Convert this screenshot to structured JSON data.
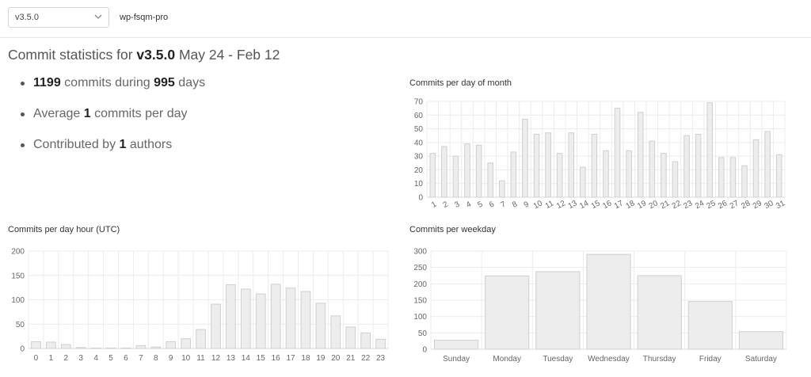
{
  "header": {
    "version_select": "v3.5.0",
    "repo": "wp-fsqm-pro"
  },
  "summary": {
    "prefix": "Commit statistics for",
    "version": "v3.5.0",
    "range": "May 24 - Feb 12"
  },
  "stats": [
    {
      "bold": "1199",
      "text": "commits during",
      "bold2": "995",
      "text2": "days"
    },
    {
      "pre": "Average",
      "bold": "1",
      "text": "commits per day"
    },
    {
      "pre": "Contributed by",
      "bold": "1",
      "text": "authors"
    }
  ],
  "colors": {
    "bar_fill": "#ededed",
    "bar_stroke": "#cfcfcf",
    "grid": "#ececec",
    "tick_text": "#666666"
  },
  "chart_data": [
    {
      "id": "day-of-month",
      "type": "bar",
      "title": "Commits per day of month",
      "categories": [
        "1",
        "2",
        "3",
        "4",
        "5",
        "6",
        "7",
        "8",
        "9",
        "10",
        "11",
        "12",
        "13",
        "14",
        "15",
        "16",
        "17",
        "18",
        "19",
        "20",
        "21",
        "22",
        "23",
        "24",
        "25",
        "26",
        "27",
        "28",
        "29",
        "30",
        "31"
      ],
      "values": [
        32,
        37,
        30,
        39,
        38,
        25,
        12,
        33,
        57,
        46,
        47,
        32,
        47,
        22,
        46,
        34,
        65,
        34,
        62,
        41,
        32,
        26,
        45,
        46,
        69,
        29,
        29,
        23,
        42,
        48,
        31
      ],
      "ylim": [
        0,
        70
      ],
      "yticks": [
        0,
        10,
        20,
        30,
        40,
        50,
        60,
        70
      ],
      "grid": true,
      "rotated_labels": true
    },
    {
      "id": "day-hour",
      "type": "bar",
      "title": "Commits per day hour (UTC)",
      "categories": [
        "0",
        "1",
        "2",
        "3",
        "4",
        "5",
        "6",
        "7",
        "8",
        "9",
        "10",
        "11",
        "12",
        "13",
        "14",
        "15",
        "16",
        "17",
        "18",
        "19",
        "20",
        "21",
        "22",
        "23"
      ],
      "values": [
        14,
        13,
        8,
        2,
        1,
        1,
        1,
        6,
        3,
        14,
        20,
        39,
        91,
        131,
        122,
        112,
        132,
        124,
        117,
        93,
        67,
        44,
        32,
        19
      ],
      "ylim": [
        0,
        200
      ],
      "yticks": [
        0,
        50,
        100,
        150,
        200
      ],
      "grid": true,
      "rotated_labels": false
    },
    {
      "id": "weekday",
      "type": "bar",
      "title": "Commits per weekday",
      "categories": [
        "Sunday",
        "Monday",
        "Tuesday",
        "Wednesday",
        "Thursday",
        "Friday",
        "Saturday"
      ],
      "values": [
        28,
        224,
        237,
        290,
        225,
        146,
        54
      ],
      "ylim": [
        0,
        300
      ],
      "yticks": [
        0,
        50,
        100,
        150,
        200,
        250,
        300
      ],
      "grid": true,
      "rotated_labels": false
    }
  ]
}
